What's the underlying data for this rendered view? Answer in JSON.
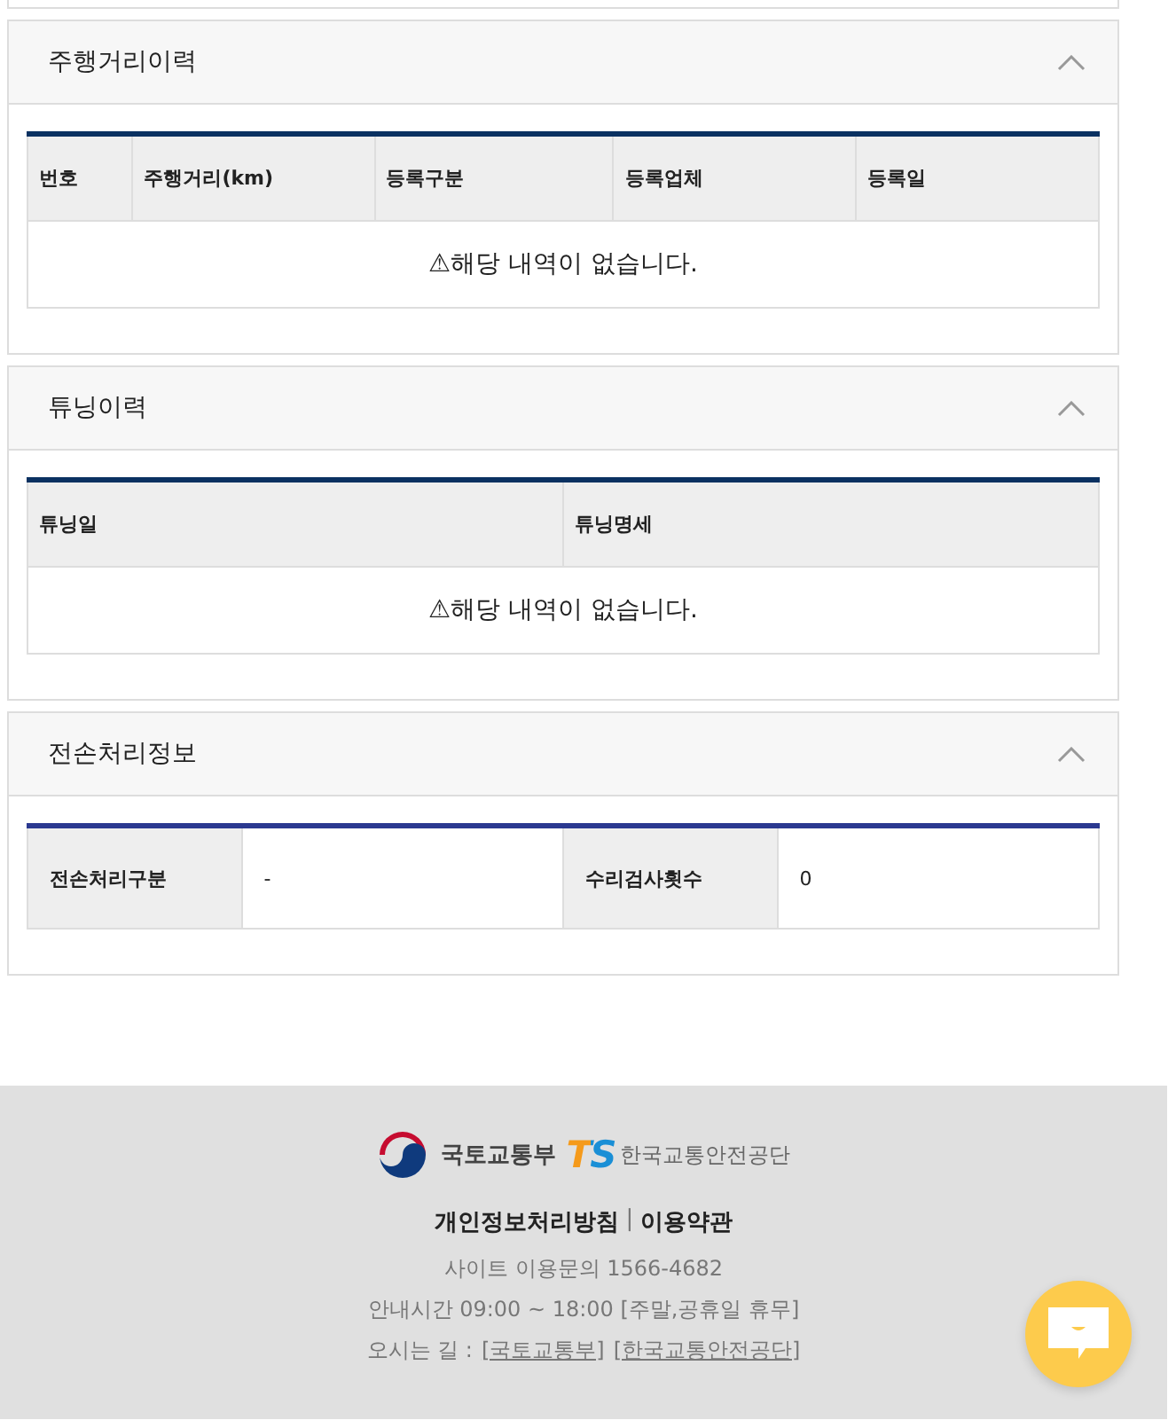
{
  "sections": [
    {
      "title": "주행거리이력",
      "expanded": true,
      "kind": "list",
      "columns": [
        "번호",
        "주행거리(km)",
        "등록구분",
        "등록업체",
        "등록일"
      ],
      "empty_message": "⚠해당 내역이 없습니다."
    },
    {
      "title": "튜닝이력",
      "expanded": true,
      "kind": "list",
      "columns": [
        "튜닝일",
        "튜닝명세"
      ],
      "empty_message": "⚠해당 내역이 없습니다."
    },
    {
      "title": "전손처리정보",
      "expanded": true,
      "kind": "detail",
      "fields": [
        {
          "label": "전손처리구분",
          "value": "-"
        },
        {
          "label": "수리검사횟수",
          "value": "0"
        }
      ]
    }
  ],
  "footer": {
    "ministry": "국토교통부",
    "ts_mark": "TS",
    "agency": "한국교통안전공단",
    "links": [
      "개인정보처리방침",
      "이용약관"
    ],
    "separator": "|",
    "contact": "사이트 이용문의 1566-4682",
    "hours": "안내시간 09:00 ~ 18:00 [주말,공휴일 휴무]",
    "directions": {
      "label": "오시는 길 :",
      "links": [
        "[국토교통부]",
        "[한국교통안전공단]"
      ]
    }
  }
}
